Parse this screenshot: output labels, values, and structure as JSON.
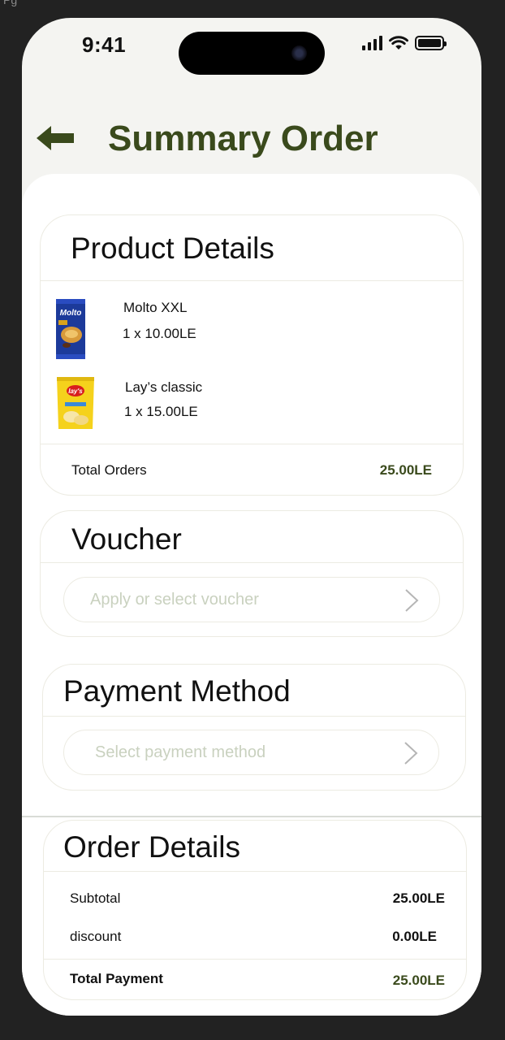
{
  "status_bar": {
    "time": "9:41"
  },
  "header": {
    "back_icon": "arrow-left-icon",
    "title": "Summary Order"
  },
  "product_details": {
    "title": "Product Details",
    "items": [
      {
        "name": "Molto XXL",
        "price_line": "1 x 10.00LE",
        "image": "molto-package"
      },
      {
        "name": "Lay’s classic",
        "price_line": "1 x 15.00LE",
        "image": "lays-package"
      }
    ],
    "total_label": "Total Orders",
    "total_value": "25.00LE"
  },
  "voucher": {
    "title": "Voucher",
    "placeholder": "Apply or select voucher",
    "chevron_icon": "chevron-right-icon"
  },
  "payment": {
    "title": "Payment Method",
    "placeholder": "Select payment method",
    "chevron_icon": "chevron-right-icon"
  },
  "order_details": {
    "title": "Order Details",
    "subtotal_label": "Subtotal",
    "subtotal_value": "25.00LE",
    "discount_label": "discount",
    "discount_value": "0.00LE",
    "total_label": "Total Payment",
    "total_value": "25.00LE"
  },
  "colors": {
    "accent": "#3a4a1c",
    "placeholder": "#c9d1bf",
    "card_border": "#ecebe2",
    "screen_bg": "#f4f4f1"
  }
}
